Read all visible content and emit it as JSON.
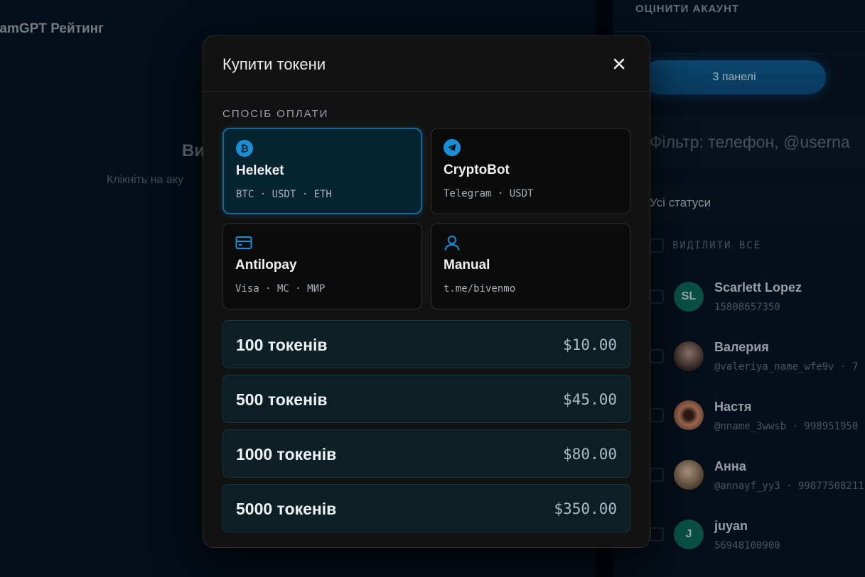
{
  "app": {
    "title": "ramGPT Рейтинг"
  },
  "empty_state": {
    "title": "Ви",
    "subtitle": "Клікніть на аку"
  },
  "right_panel": {
    "header": "ОЦІНИТИ АКАУНТ",
    "panels_button": "3 панелі",
    "filter_placeholder": "Фільтр: телефон, @userna",
    "status_filter": "Усі статуси",
    "select_all": "ВИДІЛИТИ ВСЕ",
    "accounts": [
      {
        "initials": "SL",
        "name": "Scarlett Lopez",
        "sub": "15808657350",
        "avatar_color": "#0e6b5a"
      },
      {
        "initials": "",
        "name": "Валерия",
        "sub": "@valeriya_name_wfe9v · 7",
        "avatar_color": "#5a4a42"
      },
      {
        "initials": "",
        "name": "Настя",
        "sub": "@nname_3wwsb · 998951950",
        "avatar_color": "#8a5a45"
      },
      {
        "initials": "",
        "name": "Анна",
        "sub": "@annayf_yy3 · 99877508211",
        "avatar_color": "#7b6850"
      },
      {
        "initials": "J",
        "name": "juyan",
        "sub": "56948100900",
        "avatar_color": "#0e6b5a"
      }
    ]
  },
  "modal": {
    "title": "Купити токени",
    "section_label": "СПОСІБ ОПЛАТИ",
    "payment_methods": [
      {
        "name": "Heleket",
        "sub": "BTC · USDT · ETH",
        "icon": "bitcoin-icon",
        "selected": true
      },
      {
        "name": "CryptoBot",
        "sub": "Telegram · USDT",
        "icon": "telegram-icon",
        "selected": false
      },
      {
        "name": "Antilopay",
        "sub": "Visa · MC · МИР",
        "icon": "card-icon",
        "selected": false
      },
      {
        "name": "Manual",
        "sub": "t.me/bivenmo",
        "icon": "user-icon",
        "selected": false
      }
    ],
    "packages": [
      {
        "name": "100 токенів",
        "price": "$10.00"
      },
      {
        "name": "500 токенів",
        "price": "$45.00"
      },
      {
        "name": "1000 токенів",
        "price": "$80.00"
      },
      {
        "name": "5000 токенів",
        "price": "$350.00"
      }
    ]
  },
  "colors": {
    "accent": "#1a8fd6",
    "modal_bg": "#121212",
    "package_bg": "#0c1f25"
  }
}
